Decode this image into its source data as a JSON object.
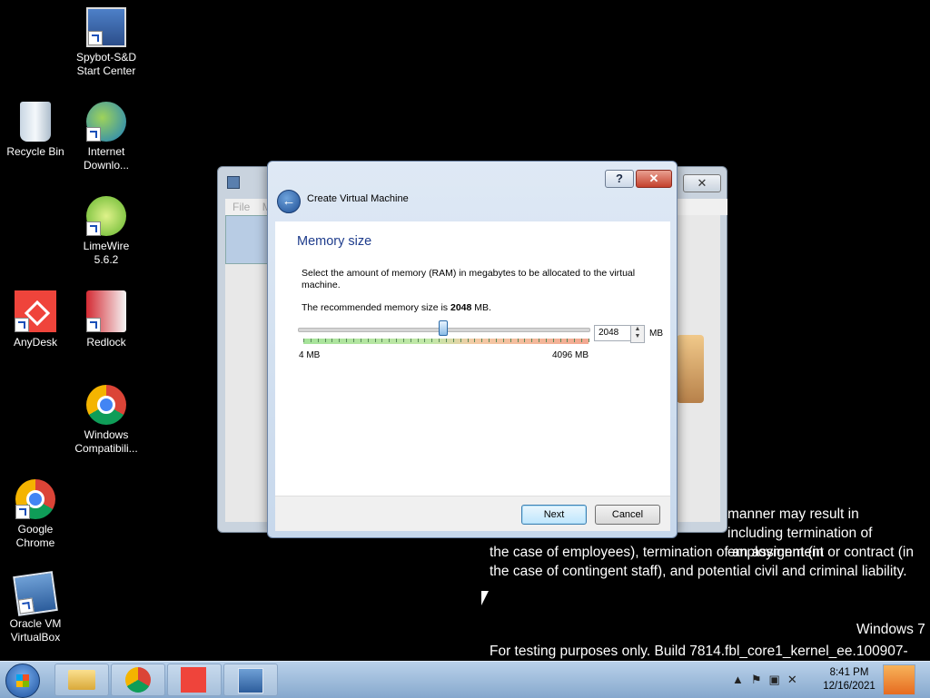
{
  "desktop": {
    "icons": [
      {
        "label": "Spybot-S&D Start Center",
        "icon": "spybot-icon"
      },
      {
        "label": "Recycle Bin",
        "icon": "recycle-bin-icon"
      },
      {
        "label": "Internet Downlo...",
        "icon": "internet-download-manager-icon"
      },
      {
        "label": "LimeWire 5.6.2",
        "icon": "limewire-icon"
      },
      {
        "label": "AnyDesk",
        "icon": "anydesk-icon"
      },
      {
        "label": "Redlock",
        "icon": "redlock-icon"
      },
      {
        "label": "Windows Compatibili...",
        "icon": "chrome-icon"
      },
      {
        "label": "Google Chrome",
        "icon": "chrome-icon"
      },
      {
        "label": "Oracle VM VirtualBox",
        "icon": "virtualbox-icon"
      }
    ],
    "legal_line1": "manner may result in",
    "legal_line2": "including termination of employment (in",
    "legal_line3": "the case of employees), termination of an assignment or contract (in",
    "legal_line4": "the case of contingent staff), and potential civil and criminal liability.",
    "os_name": "Windows 7",
    "build_info": "For testing purposes only. Build 7814.fbl_core1_kernel_ee.100907-1700"
  },
  "background_window": {
    "menu_file": "File",
    "menu_m": "M"
  },
  "dialog": {
    "help": "?",
    "close": "✕",
    "title": "Create Virtual Machine",
    "heading": "Memory size",
    "description": "Select the amount of memory (RAM) in megabytes to be allocated to the virtual machine.",
    "recommended_prefix": "The recommended memory size is ",
    "recommended_value": "2048",
    "recommended_suffix": " MB.",
    "slider_value_fraction": 0.5,
    "min_label": "4 MB",
    "max_label": "4096 MB",
    "memory_value": "2048",
    "unit": "MB",
    "next_label": "Next",
    "cancel_label": "Cancel"
  },
  "taskbar": {
    "time": "8:41 PM",
    "date": "12/16/2021"
  }
}
